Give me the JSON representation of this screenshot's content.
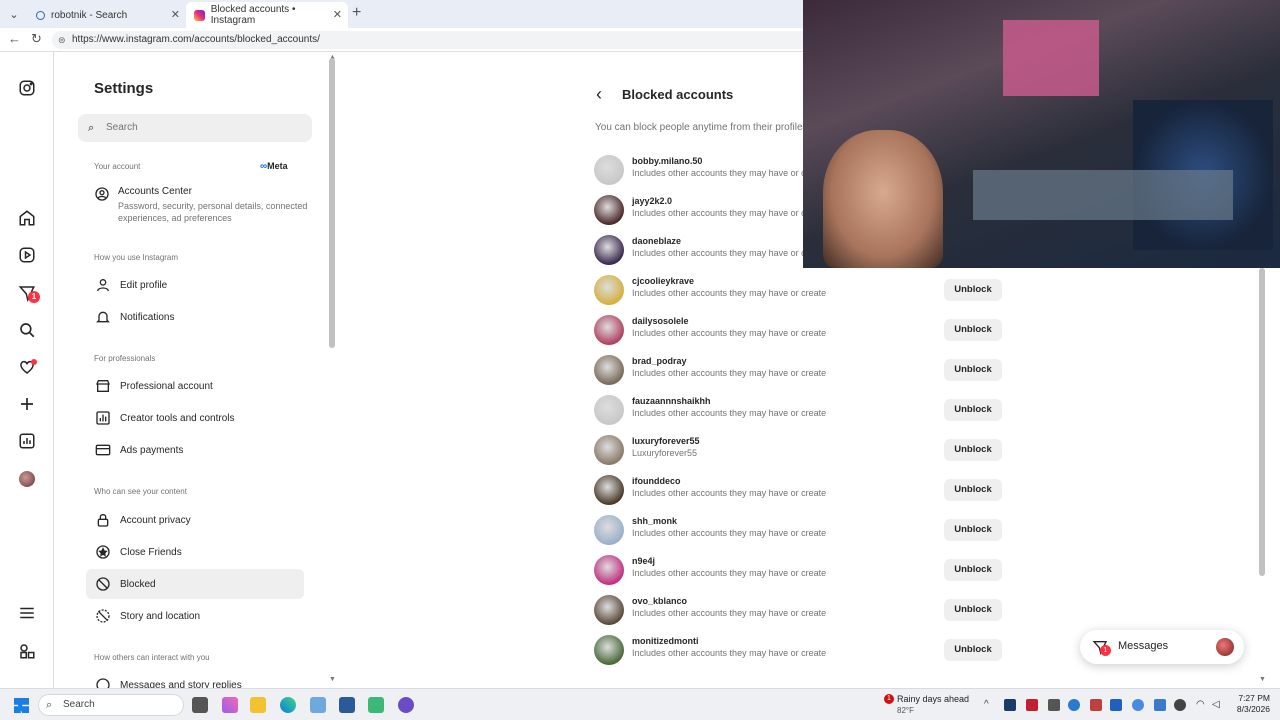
{
  "browser": {
    "tabs": [
      {
        "title": "robotnik - Search"
      },
      {
        "title": "Blocked accounts • Instagram"
      }
    ],
    "url": "https://www.instagram.com/accounts/blocked_accounts/"
  },
  "rail": {
    "notifications_badge": "1"
  },
  "settings": {
    "title": "Settings",
    "search_placeholder": "Search",
    "your_account": "Your account",
    "meta_label": "Meta",
    "accounts_center": {
      "title": "Accounts Center",
      "desc": "Password, security, personal details, connected experiences, ad preferences"
    },
    "how_you_use": "How you use Instagram",
    "edit_profile": "Edit profile",
    "notifications": "Notifications",
    "for_professionals": "For professionals",
    "professional_account": "Professional account",
    "creator_tools": "Creator tools and controls",
    "ads_payments": "Ads payments",
    "who_can_see": "Who can see your content",
    "account_privacy": "Account privacy",
    "close_friends": "Close Friends",
    "blocked": "Blocked",
    "story_location": "Story and location",
    "how_others": "How others can interact with you",
    "messages_replies": "Messages and story replies"
  },
  "main": {
    "title": "Blocked accounts",
    "description": "You can block people anytime from their profiles.",
    "unblock_label": "Unblock",
    "accounts": [
      {
        "username": "bobby.milano.50",
        "sub": "Includes other accounts they may have or create",
        "avatar": "#c8c8c8",
        "show_button": false
      },
      {
        "username": "jayy2k2.0",
        "sub": "Includes other accounts they may have or create",
        "avatar": "#4a2a2a",
        "show_button": false
      },
      {
        "username": "daoneblaze",
        "sub": "Includes other accounts they may have or create",
        "avatar": "#3a2a50",
        "show_button": false
      },
      {
        "username": "cjcoolieykrave",
        "sub": "Includes other accounts they may have or create",
        "avatar": "#d4b040",
        "show_button": true
      },
      {
        "username": "dailysosolele",
        "sub": "Includes other accounts they may have or create",
        "avatar": "#b04060",
        "show_button": true
      },
      {
        "username": "brad_podray",
        "sub": "Includes other accounts they may have or create",
        "avatar": "#7a6a5a",
        "show_button": true
      },
      {
        "username": "fauzaannnshaikhh",
        "sub": "Includes other accounts they may have or create",
        "avatar": "#c8c8c8",
        "show_button": true
      },
      {
        "username": "luxuryforever55",
        "sub": "Luxuryforever55",
        "avatar": "#8a7a6a",
        "show_button": true
      },
      {
        "username": "ifounddeco",
        "sub": "Includes other accounts they may have or create",
        "avatar": "#4a3a2a",
        "show_button": true
      },
      {
        "username": "shh_monk",
        "sub": "Includes other accounts they may have or create",
        "avatar": "#9ab0c8",
        "show_button": true
      },
      {
        "username": "n9e4j",
        "sub": "Includes other accounts they may have or create",
        "avatar": "#c03080",
        "show_button": true
      },
      {
        "username": "ovo_kblanco",
        "sub": "Includes other accounts they may have or create",
        "avatar": "#5a4a3a",
        "show_button": true
      },
      {
        "username": "monitizedmonti",
        "sub": "Includes other accounts they may have or create",
        "avatar": "#4a6a3a",
        "show_button": true
      }
    ]
  },
  "messages": {
    "label": "Messages",
    "badge": "1"
  },
  "taskbar": {
    "search": "Search",
    "weather_title": "Rainy days ahead",
    "weather_temp": "82°F",
    "weather_badge": "1",
    "time": "7:27 PM",
    "date": "8/3/2026"
  }
}
